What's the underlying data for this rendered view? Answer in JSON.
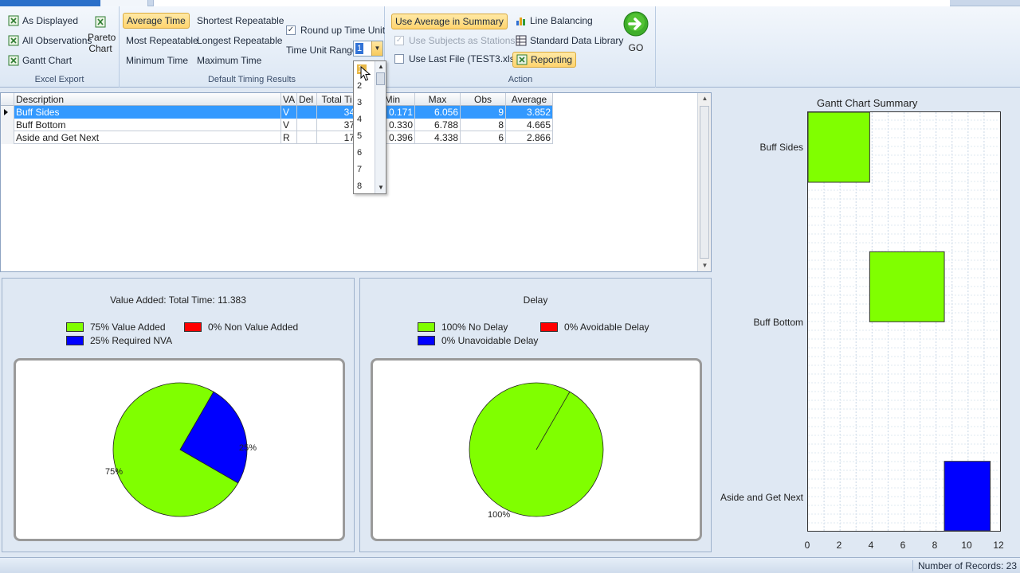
{
  "ribbon": {
    "excel_export": {
      "label": "Excel Export",
      "as_displayed": "As Displayed",
      "all_observations": "All Observations",
      "gantt_chart": "Gantt Chart",
      "pareto_line1": "Pareto",
      "pareto_line2": "Chart"
    },
    "default_timing": {
      "label": "Default Timing Results",
      "average_time": "Average Time",
      "shortest_repeatable": "Shortest Repeatable",
      "most_repeatable": "Most Repeatable",
      "longest_repeatable": "Longest Repeatable",
      "minimum_time": "Minimum Time",
      "maximum_time": "Maximum Time",
      "round_up": "Round up Time Unit",
      "time_unit_range": "Time Unit Range",
      "time_unit_value": "1"
    },
    "action": {
      "label": "Action",
      "use_average": "Use Average in Summary",
      "use_subjects": "Use Subjects as Stations",
      "use_last_file": "Use Last File (TEST3.xls)",
      "line_balancing": "Line Balancing",
      "standard_data": "Standard Data Library",
      "reporting": "Reporting",
      "go": "GO"
    }
  },
  "dropdown": {
    "options": [
      "1",
      "2",
      "3",
      "4",
      "5",
      "6",
      "7",
      "8"
    ]
  },
  "grid": {
    "columns": [
      "Description",
      "VA",
      "Del",
      "Total Ti",
      "Min",
      "Max",
      "Obs",
      "Average"
    ],
    "rows": [
      {
        "description": "Buff Sides",
        "va": "V",
        "del": "",
        "total": "34",
        "min": "0.171",
        "max": "6.056",
        "obs": "9",
        "avg": "3.852"
      },
      {
        "description": "Buff Bottom",
        "va": "V",
        "del": "",
        "total": "37",
        "min": "0.330",
        "max": "6.788",
        "obs": "8",
        "avg": "4.665"
      },
      {
        "description": "Aside and Get Next",
        "va": "R",
        "del": "",
        "total": "17",
        "min": "0.396",
        "max": "4.338",
        "obs": "6",
        "avg": "2.866"
      }
    ]
  },
  "value_added": {
    "title": "Value Added: Total Time: 11.383",
    "legend": [
      "75% Value Added",
      "0% Non Value Added",
      "25% Required NVA"
    ],
    "pie_labels": [
      "75%",
      "25%"
    ],
    "colors": {
      "va": "#80ff00",
      "nva": "#ff0000",
      "req": "#0000ff"
    }
  },
  "delay": {
    "title": "Delay",
    "legend": [
      "100% No Delay",
      "0% Avoidable Delay",
      "0% Unavoidable Delay"
    ],
    "pie_labels": [
      "100%"
    ]
  },
  "gantt": {
    "title": "Gantt Chart Summary",
    "rows": [
      "Buff Sides",
      "Buff Bottom",
      "Aside and Get Next"
    ],
    "ticks": [
      "0",
      "2",
      "4",
      "6",
      "8",
      "10",
      "12"
    ]
  },
  "chart_data": [
    {
      "type": "pie",
      "title": "Value Added: Total Time: 11.383",
      "categories": [
        "Value Added",
        "Non Value Added",
        "Required NVA"
      ],
      "values": [
        75,
        0,
        25
      ]
    },
    {
      "type": "pie",
      "title": "Delay",
      "categories": [
        "No Delay",
        "Avoidable Delay",
        "Unavoidable Delay"
      ],
      "values": [
        100,
        0,
        0
      ]
    },
    {
      "type": "bar",
      "title": "Gantt Chart Summary",
      "categories": [
        "Buff Sides",
        "Buff Bottom",
        "Aside and Get Next"
      ],
      "series": [
        {
          "start": [
            0,
            3.852,
            8.517
          ],
          "end": [
            3.852,
            8.517,
            11.383
          ]
        }
      ],
      "xlim": [
        0,
        12
      ],
      "grid": true
    }
  ],
  "status": {
    "records": "Number of Records: 23"
  }
}
